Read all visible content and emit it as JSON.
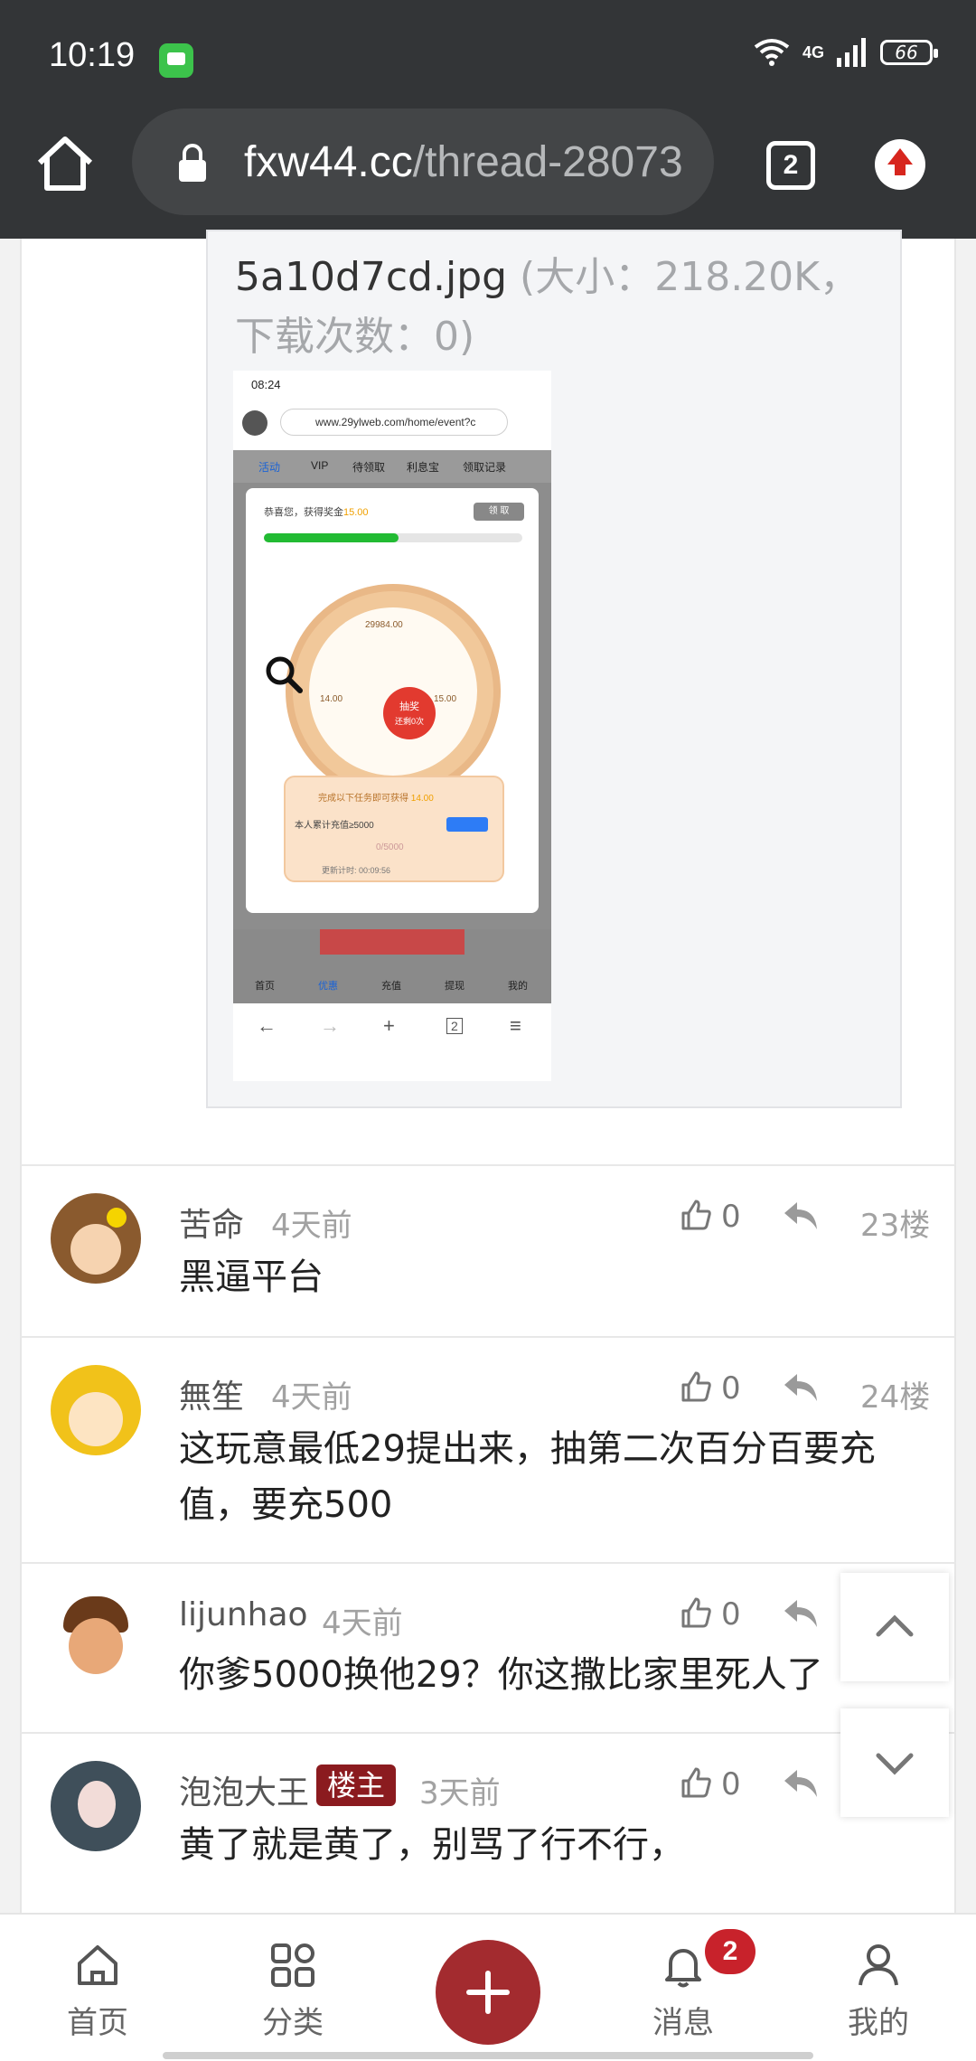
{
  "status_bar": {
    "time": "10:19",
    "network": "4G",
    "battery": "66",
    "icons": [
      "message-app-icon",
      "wifi-icon",
      "signal-icon",
      "battery-icon"
    ]
  },
  "browser": {
    "url_host": "fxw44.cc",
    "url_path": "/thread-28073",
    "tab_count": "2",
    "icons": [
      "home-icon",
      "lock-icon",
      "tab-switcher-icon",
      "update-icon"
    ]
  },
  "attachment": {
    "filename": "5a10d7cd.jpg",
    "meta": " (大小：218.20K，下载次数：0)"
  },
  "thumbnail": {
    "time": "08:24",
    "url": "www.29ylweb.com/home/event?c",
    "tabs": [
      "活动",
      "VIP",
      "待领取",
      "利息宝",
      "领取记录"
    ],
    "congrats": "恭喜您，获得奖金",
    "amount": "15.00",
    "claim": "领 取",
    "jackpot": "29984.00",
    "hub_label": "抽奖",
    "hub_sub": "还剩0次",
    "left_value": "14.00",
    "right_value": "15.00",
    "task_text": "完成以下任务即可获得",
    "task_amount": "14.00",
    "deposit_text": "本人累计充值≥5000",
    "progress": "0/5000",
    "timer": "更新计时: 00:09:56",
    "bottom_tabs": [
      "首页",
      "优惠",
      "充值",
      "提现",
      "我的"
    ],
    "nav_icons": [
      "←",
      "→",
      "+",
      "2",
      "≡"
    ]
  },
  "comments": [
    {
      "name": "苦命",
      "time": "4天前",
      "likes": "0",
      "floor": "23楼",
      "text": "黑逼平台",
      "op": false
    },
    {
      "name": "無笙",
      "time": "4天前",
      "likes": "0",
      "floor": "24楼",
      "text": "这玩意最低29提出来，抽第二次百分百要充值，要充500",
      "op": false
    },
    {
      "name": "lijunhao",
      "time": "4天前",
      "likes": "0",
      "floor": "",
      "text": "你爹5000换他29？你这撒比家里死人了",
      "op": false
    },
    {
      "name": "泡泡大王",
      "badge": "楼主",
      "time": "3天前",
      "likes": "0",
      "floor": "",
      "text": "黄了就是黄了，别骂了行不行，",
      "op": true
    }
  ],
  "bottom_nav": {
    "items": [
      {
        "label": "首页",
        "icon": "home-outline-icon"
      },
      {
        "label": "分类",
        "icon": "category-grid-icon"
      },
      {
        "label": "消息",
        "icon": "bell-icon"
      },
      {
        "label": "我的",
        "icon": "user-icon"
      }
    ],
    "message_badge": "2",
    "fab_icon": "plus-icon"
  },
  "colors": {
    "browser_chrome": "#333537",
    "brand_red": "#a32b2f",
    "op_badge": "#8b1b1f",
    "notification_badge": "#c8222b"
  }
}
